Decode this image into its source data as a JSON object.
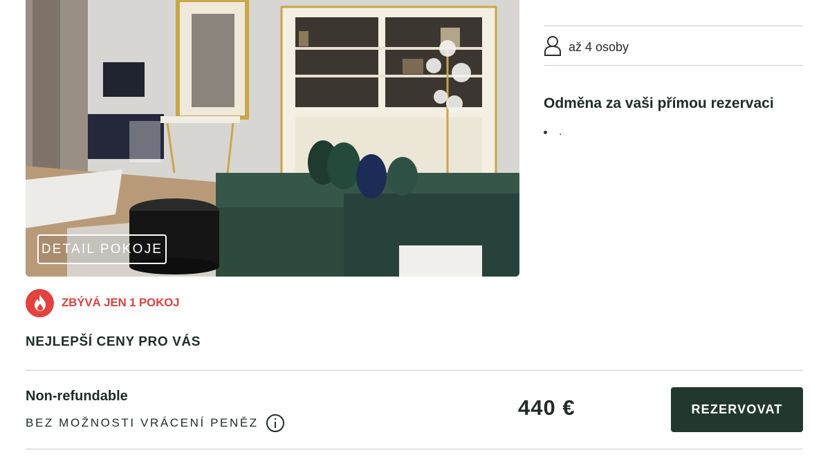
{
  "room": {
    "detail_button": "DETAIL POKOJE",
    "capacity_text": "až 4 osoby",
    "reward_title": "Odměna za vaši přímou rezervaci",
    "reward_items": [
      "."
    ],
    "availability_text": "ZBÝVÁ JEN 1 POKOJ",
    "best_prices_text": "NEJLEPŠÍ CENY PRO VÁS"
  },
  "rate": {
    "name": "Non-refundable",
    "policy": "BEZ MOŽNOSTI VRÁCENÍ PENĚZ",
    "price": "440 €",
    "book_button": "REZERVOVAT"
  },
  "icons": {
    "capacity": "person-icon",
    "availability": "fire-icon",
    "policy": "info-icon"
  },
  "colors": {
    "accent_dark_green": "#22382f",
    "alert_red": "#e1433f",
    "text_dark": "#1f2b26"
  }
}
